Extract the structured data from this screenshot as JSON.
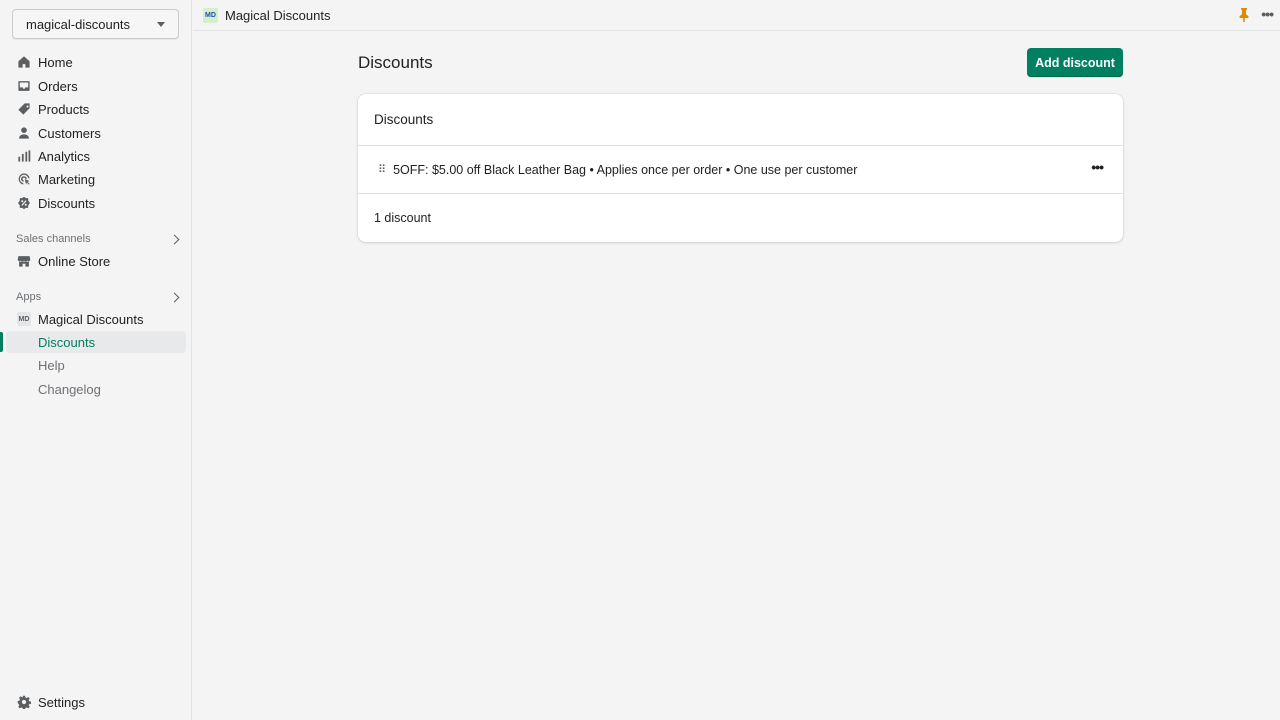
{
  "store": {
    "name": "magical-discounts"
  },
  "nav": {
    "items": [
      {
        "label": "Home",
        "icon": "home-icon"
      },
      {
        "label": "Orders",
        "icon": "inbox-icon"
      },
      {
        "label": "Products",
        "icon": "tag-icon"
      },
      {
        "label": "Customers",
        "icon": "person-icon"
      },
      {
        "label": "Analytics",
        "icon": "bar-chart-icon"
      },
      {
        "label": "Marketing",
        "icon": "target-icon"
      },
      {
        "label": "Discounts",
        "icon": "discount-badge-icon"
      }
    ],
    "sales_channels_label": "Sales channels",
    "online_store": "Online Store",
    "apps_label": "Apps",
    "app_name": "Magical Discounts",
    "app_sub_items": [
      "Discounts",
      "Help",
      "Changelog"
    ],
    "settings": "Settings"
  },
  "topbar": {
    "app_name": "Magical Discounts",
    "app_logo_text": "MD"
  },
  "page": {
    "title": "Discounts",
    "add_button": "Add discount",
    "card_title": "Discounts",
    "discounts": [
      {
        "text": "5OFF: $5.00 off Black Leather Bag • Applies once per order • One use per customer"
      }
    ],
    "footer": "1 discount"
  },
  "colors": {
    "accent": "#008060",
    "pin": "#e08a00"
  }
}
